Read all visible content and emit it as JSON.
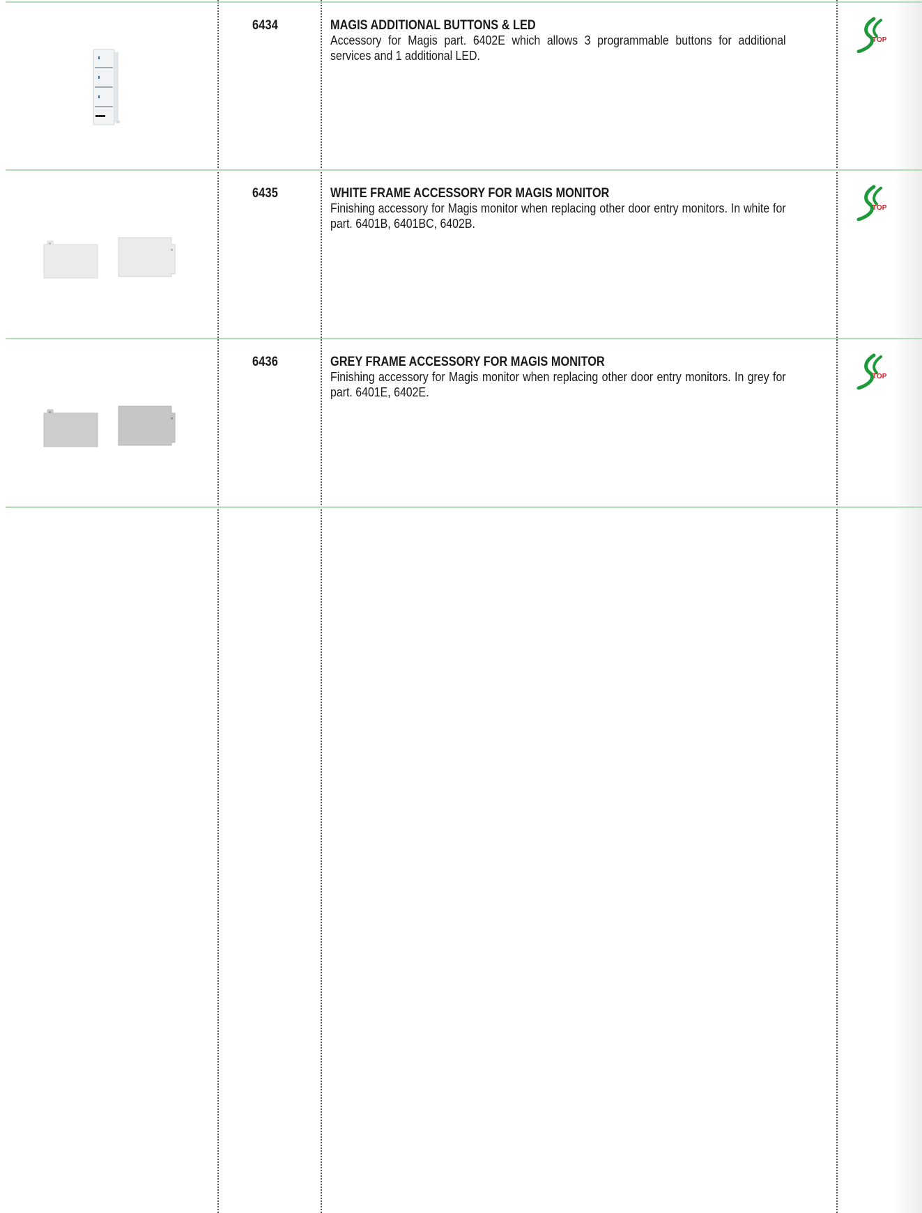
{
  "products": [
    {
      "code": "6434",
      "title": "MAGIS ADDITIONAL BUTTONS & LED",
      "description": "Accessory for Magis part. 6402E which allows 3 programmable buttons for additional services and 1 additional LED.",
      "image": "magis-keypad-module",
      "logo": "TOP"
    },
    {
      "code": "6435",
      "title": "WHITE FRAME ACCESSORY FOR MAGIS MONITOR",
      "description": "Finishing accessory for Magis monitor when replacing other door entry monitors. In white for part. 6401B, 6401BC, 6402B.",
      "image": "white-frame-pair",
      "logo": "TOP"
    },
    {
      "code": "6436",
      "title": "GREY FRAME ACCESSORY FOR MAGIS MONITOR",
      "description": "Finishing accessory for Magis monitor when replacing other door entry monitors. In grey for part. 6401E, 6402E.",
      "image": "grey-frame-pair",
      "logo": "TOP"
    }
  ],
  "colors": {
    "row_divider": "#b4dcb6",
    "column_divider": "#555555",
    "logo_green": "#1e9a3a",
    "logo_red": "#d41f2b",
    "white_frame": "#ececec",
    "grey_frame": "#c9c9c9"
  }
}
